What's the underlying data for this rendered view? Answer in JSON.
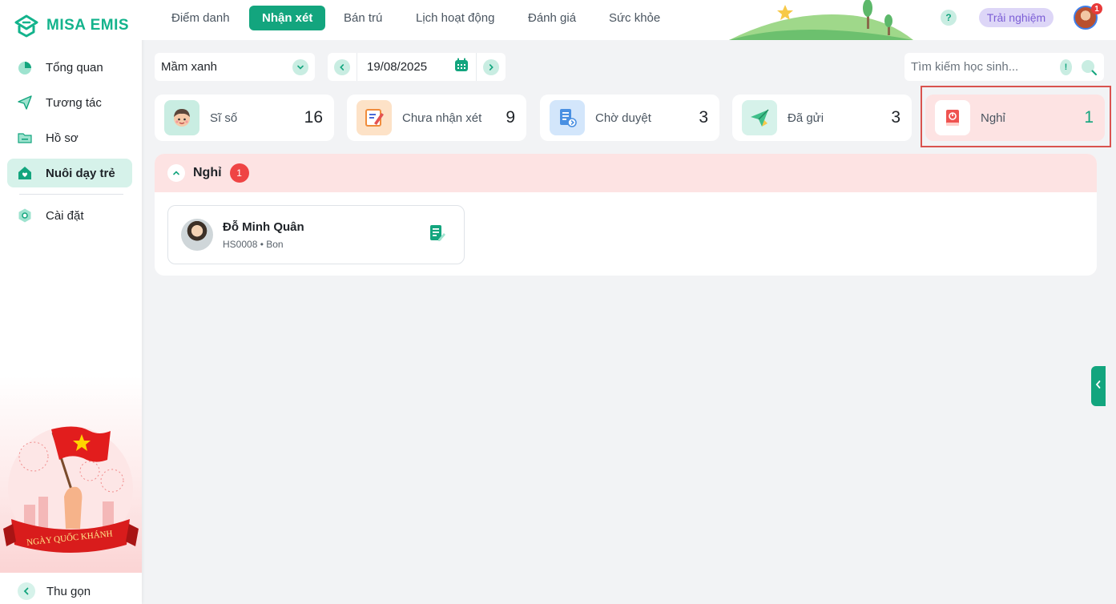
{
  "brand": {
    "name": "MISA EMIS",
    "color": "#13b38c"
  },
  "sidebar": {
    "items": [
      {
        "label": "Tổng quan",
        "icon": "pie-chart-icon"
      },
      {
        "label": "Tương tác",
        "icon": "paper-plane-icon"
      },
      {
        "label": "Hồ sơ",
        "icon": "folder-icon"
      },
      {
        "label": "Nuôi dạy trẻ",
        "icon": "heart-house-icon",
        "active": true
      },
      {
        "label": "Cài đặt",
        "icon": "gear-icon"
      }
    ],
    "promo_text": "NGÀY QUỐC KHÁNH",
    "collapse_label": "Thu gọn"
  },
  "topnav": {
    "tabs": [
      {
        "label": "Điểm danh"
      },
      {
        "label": "Nhận xét",
        "active": true
      },
      {
        "label": "Bán trú"
      },
      {
        "label": "Lịch hoạt động"
      },
      {
        "label": "Đánh giá"
      },
      {
        "label": "Sức khỏe"
      }
    ],
    "help_label": "?",
    "trial_label": "Trải nghiệm",
    "notification_count": "1"
  },
  "filters": {
    "class_value": "Mầm xanh",
    "date_value": "19/08/2025",
    "search_placeholder": "Tìm kiếm học sinh...",
    "search_info": "!"
  },
  "stats": [
    {
      "label": "Sĩ số",
      "value": "16",
      "icon": "student-face-icon",
      "icon_bg": "#c9ede2"
    },
    {
      "label": "Chưa nhận xét",
      "value": "9",
      "icon": "edit-board-icon",
      "icon_bg": "#fde2c7"
    },
    {
      "label": "Chờ duyệt",
      "value": "3",
      "icon": "pending-doc-icon",
      "icon_bg": "#d3e6fb"
    },
    {
      "label": "Đã gửi",
      "value": "3",
      "icon": "sent-plane-icon",
      "icon_bg": "#d6f2ea"
    },
    {
      "label": "Nghỉ",
      "value": "1",
      "icon": "absent-book-icon",
      "icon_bg": "#ffffff",
      "selected": true
    }
  ],
  "section": {
    "title": "Nghỉ",
    "count": "1",
    "students": [
      {
        "name": "Đỗ Minh Quân",
        "meta": "HS0008 • Bon"
      }
    ]
  },
  "colors": {
    "accent": "#13a57e",
    "absent_bg": "#fde3e3",
    "badge_red": "#ef4444",
    "highlight_border": "#d9534f"
  }
}
